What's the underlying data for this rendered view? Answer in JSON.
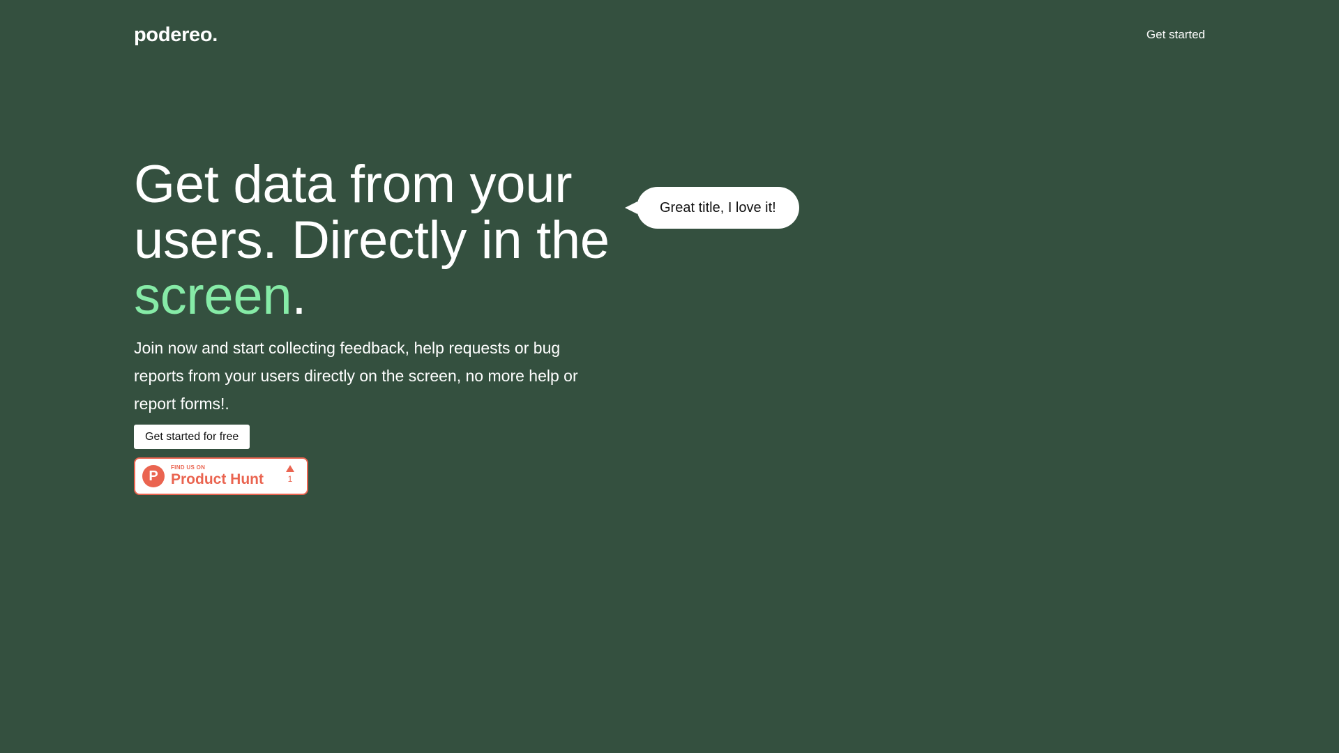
{
  "header": {
    "logo": "podereo.",
    "nav_cta": "Get started"
  },
  "hero": {
    "headline_main": "Get data from your users. Directly in the ",
    "headline_accent": "screen",
    "headline_end": ".",
    "subtext": "Join now and start collecting feedback, help requests or bug reports from your users directly on the screen, no more help or report forms!.",
    "cta_label": "Get started for free"
  },
  "product_hunt": {
    "small_label": "FIND US ON",
    "big_label": "Product Hunt",
    "upvotes": "1",
    "logo_letter": "P"
  },
  "bubble": {
    "text": "Great title, I love it!"
  },
  "colors": {
    "background": "#34503f",
    "accent": "#86eba7",
    "product_hunt": "#ea6450"
  }
}
